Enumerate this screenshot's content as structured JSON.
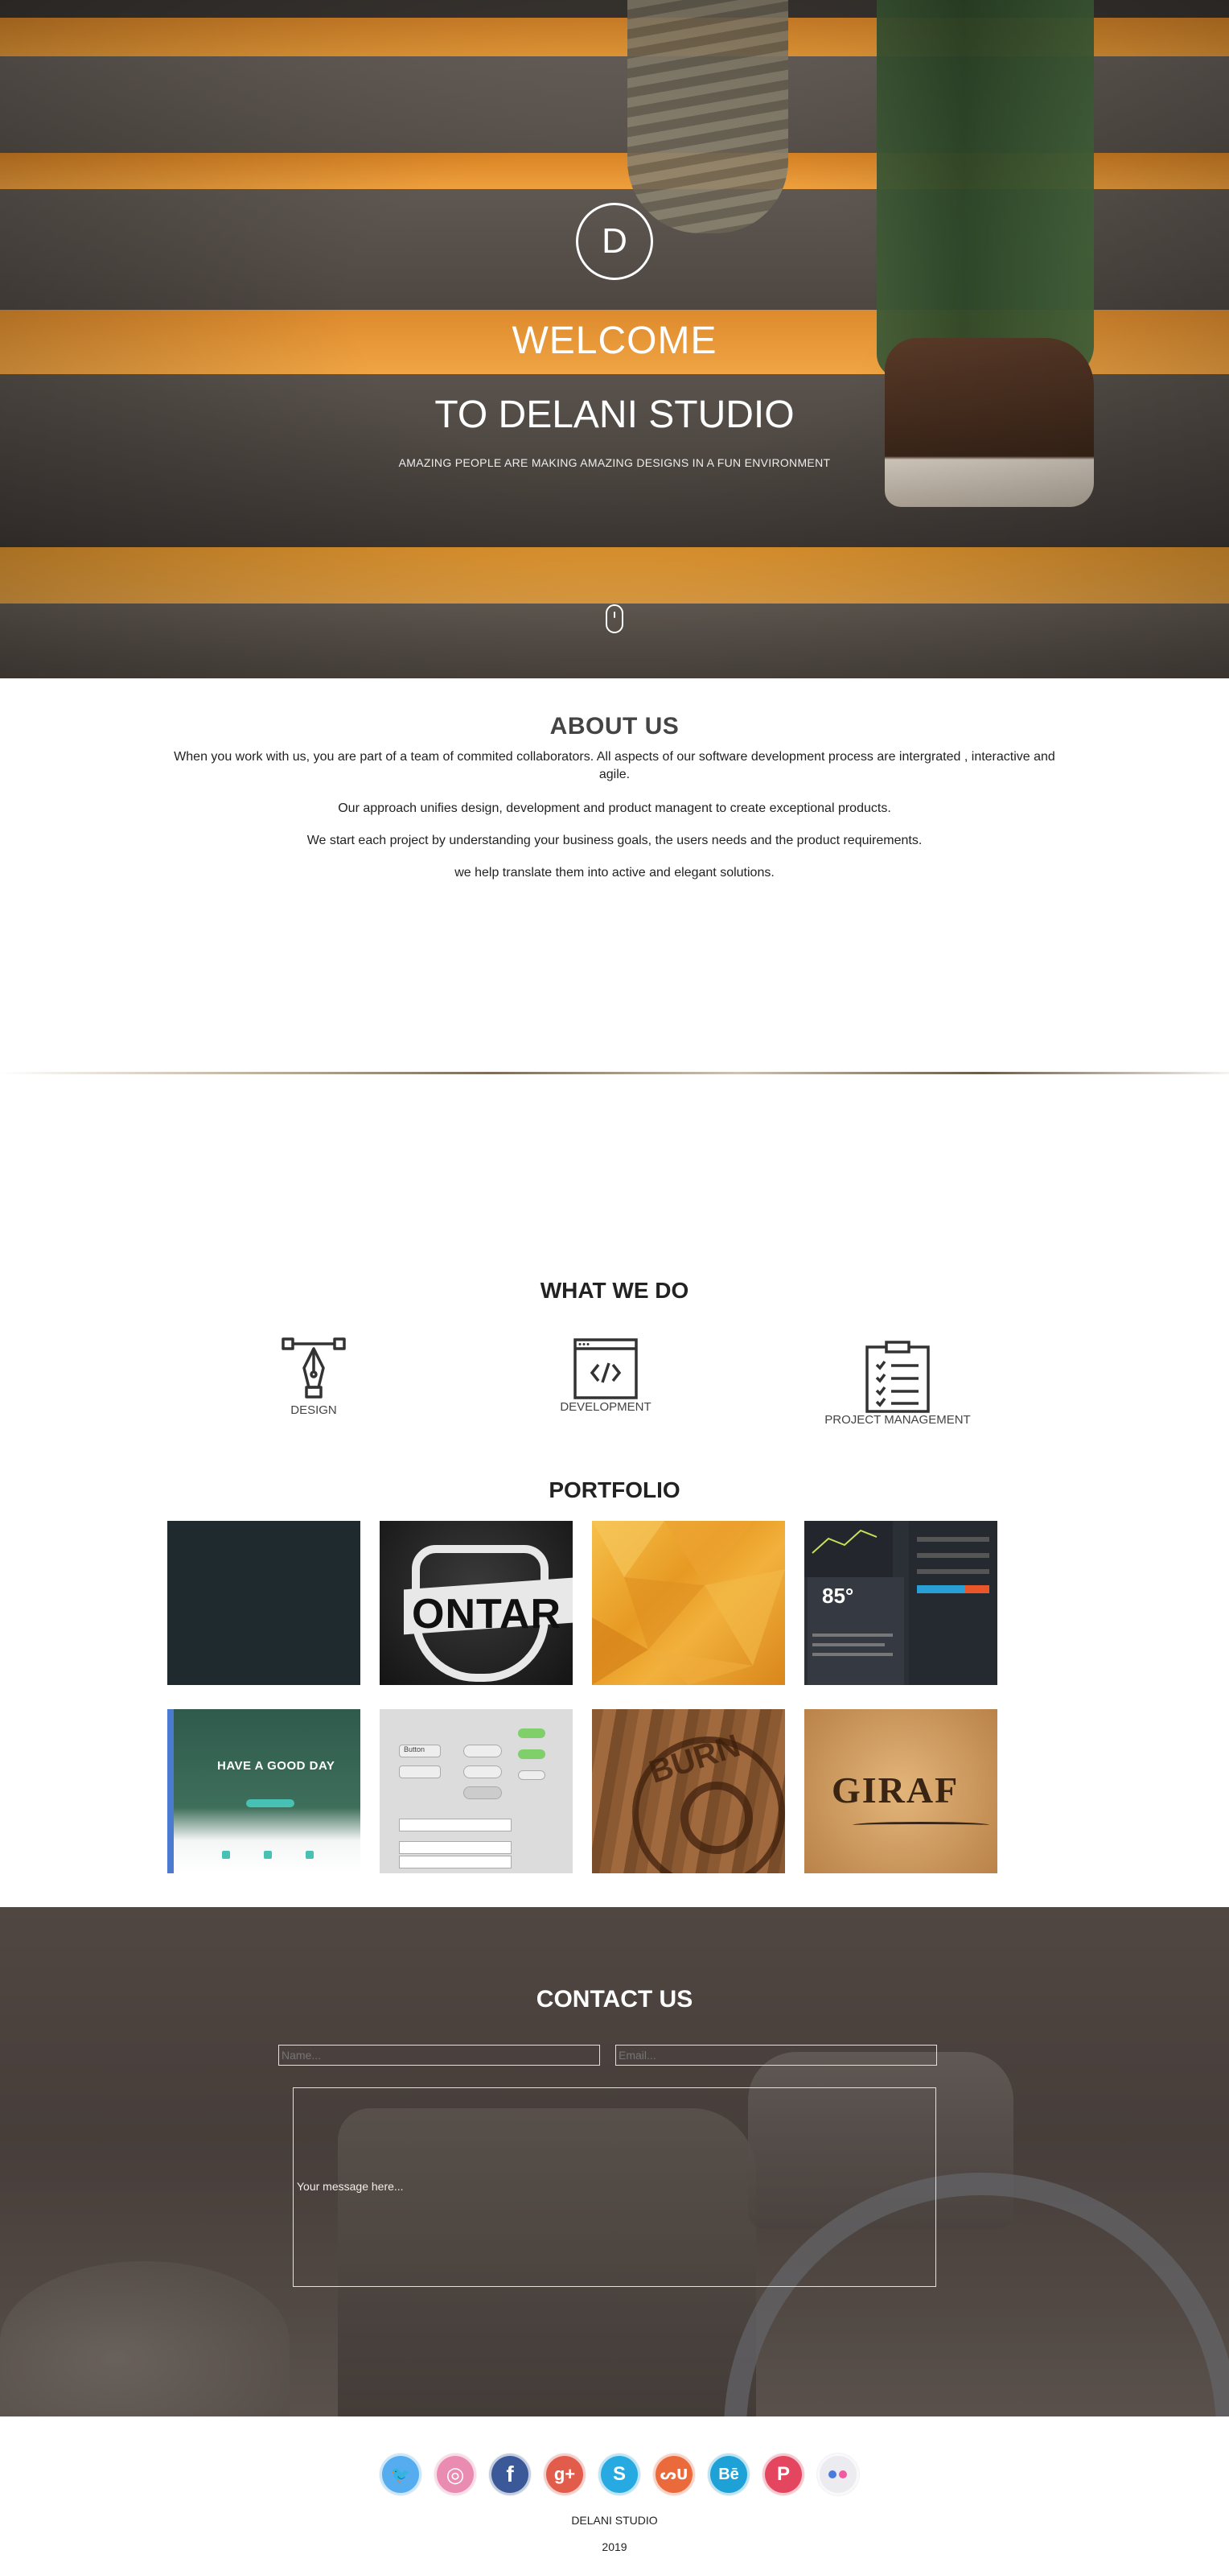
{
  "hero": {
    "logo_letter": "D",
    "title_line1": "WELCOME",
    "title_line2": "TO DELANI STUDIO",
    "subtitle": "AMAZING PEOPLE ARE MAKING AMAZING DESIGNS IN A FUN ENVIRONMENT"
  },
  "about": {
    "title": "ABOUT US",
    "paragraphs": [
      "When you work with us, you are part of a team of commited collaborators. All aspects of our software development process are intergrated , interactive and agile.",
      "Our approach unifies design, development and product managent to create exceptional products.",
      "We start each project by understanding your business goals, the users needs and the product requirements.",
      "we help translate them into active and elegant solutions."
    ]
  },
  "what_we_do": {
    "title": "WHAT WE DO",
    "services": [
      {
        "label": "DESIGN",
        "icon": "pen-tool-icon"
      },
      {
        "label": "DEVELOPMENT",
        "icon": "code-window-icon"
      },
      {
        "label": "PROJECT MANAGEMENT",
        "icon": "clipboard-checklist-icon"
      }
    ]
  },
  "portfolio": {
    "title": "PORTFOLIO",
    "tiles": [
      {
        "name": "dark-slate",
        "text": ""
      },
      {
        "name": "ontario-badge",
        "text": "ONTAR"
      },
      {
        "name": "orange-polygons",
        "text": ""
      },
      {
        "name": "weather-dashboard",
        "text": "85°"
      },
      {
        "name": "website-mockup",
        "text": "HAVE A GOOD DAY"
      },
      {
        "name": "ui-kit-buttons",
        "text": "Button"
      },
      {
        "name": "wood-stamp",
        "text": "BURN"
      },
      {
        "name": "giraffe-restaurant",
        "text": "GIRAF"
      }
    ]
  },
  "contact": {
    "title": "CONTACT US",
    "name_placeholder": "Name...",
    "email_placeholder": "Email...",
    "message_placeholder": "Your message here..."
  },
  "footer": {
    "social": [
      {
        "name": "twitter-icon",
        "glyph": "🐦",
        "color": "#55acee"
      },
      {
        "name": "dribbble-icon",
        "glyph": "◎",
        "color": "#ea4c89"
      },
      {
        "name": "facebook-icon",
        "glyph": "f",
        "color": "#3b5998"
      },
      {
        "name": "google-plus-icon",
        "glyph": "g+",
        "color": "#dd4b39"
      },
      {
        "name": "skype-icon",
        "glyph": "S",
        "color": "#00aff0"
      },
      {
        "name": "stumbleupon-icon",
        "glyph": "ᔕᑌ",
        "color": "#eb4924"
      },
      {
        "name": "behance-icon",
        "glyph": "Bē",
        "color": "#1769ff"
      },
      {
        "name": "pinterest-icon",
        "glyph": "P",
        "color": "#cb2027"
      },
      {
        "name": "flickr-icon",
        "glyph": "●●",
        "color": "#e8e8ec"
      }
    ],
    "studio_name": "DELANI STUDIO",
    "year": "2019"
  }
}
